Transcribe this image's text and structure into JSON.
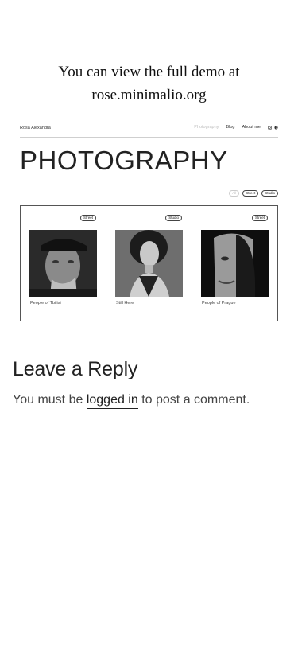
{
  "demo_note": {
    "line1": "You can view the full demo at",
    "line2": "rose.minimalio.org"
  },
  "preview": {
    "site_name": "Rosa Alexandra",
    "nav": [
      {
        "label": "Photography",
        "active": true
      },
      {
        "label": "Blog",
        "active": false
      },
      {
        "label": "About me",
        "active": false
      }
    ],
    "social_icons": [
      "instagram-icon",
      "pinterest-icon"
    ],
    "page_title": "PHOTOGRAPHY",
    "filters": [
      "All",
      "Street",
      "Studio"
    ],
    "cards": [
      {
        "tag": "Street",
        "title": "People of Tbilisi",
        "photo": "man-with-cap-portrait"
      },
      {
        "tag": "Studio",
        "title": "Still Here",
        "photo": "woman-studio-portrait"
      },
      {
        "tag": "Street",
        "title": "People of Prague",
        "photo": "old-man-portrait"
      }
    ]
  },
  "reply": {
    "title": "Leave a Reply",
    "text_before": "You must be ",
    "link": "logged in",
    "text_after": " to post a comment."
  }
}
